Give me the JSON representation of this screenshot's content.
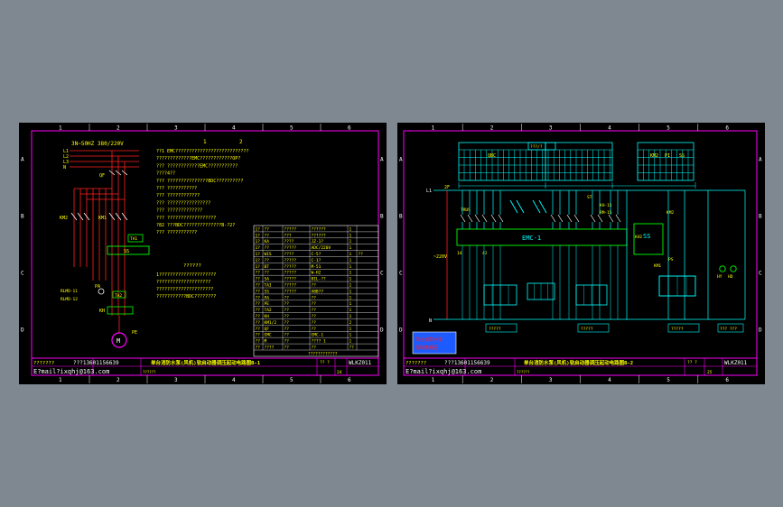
{
  "zones": {
    "cols": [
      "1",
      "2",
      "3",
      "4",
      "5",
      "6"
    ],
    "rows": [
      "A",
      "B",
      "C",
      "D"
    ]
  },
  "sheet1": {
    "supply": "3N~50HZ 380/220V",
    "phases": [
      "L1",
      "L2",
      "L3",
      "N"
    ],
    "labels": {
      "qf": "QF",
      "km2": "KM2",
      "km1": "KM1",
      "tai": "TA1",
      "ss": "SS",
      "pa": "PA",
      "rlmd11": "RLMD-11",
      "rlmd12": "RLMD-12",
      "tai2": "TA2",
      "kh": "KH",
      "m": "M",
      "pe": "PE"
    },
    "notes_header": [
      "1",
      "2"
    ],
    "notes": [
      "??1 EMC???????????????????????????",
      "?????????????EMC????????????OP?",
      "??? ????????????EMC???????????",
      "????4??",
      "??? ???????????????BDC??????????",
      "??? ???????????",
      "??? ????????????",
      "??? ????????????????",
      "??? ?????????????",
      "??? ??????????????????",
      "?82 ???BDC??????????????B-?2?",
      "??? ???????????"
    ],
    "mid_title": "??????",
    "mid_notes": [
      "1?????????????????????",
      "????????????????????",
      "?????????????????????",
      "???????????BDC????????"
    ],
    "table": {
      "rows": [
        [
          "1?",
          "??",
          "?????",
          "??????",
          "1",
          ""
        ],
        [
          "1?",
          "??",
          "???",
          "??????",
          "1",
          ""
        ],
        [
          "1?",
          "KA",
          "????",
          "JZ-1?",
          "1",
          ""
        ],
        [
          "1?",
          "??",
          "?????",
          "ADC/220V",
          "1",
          ""
        ],
        [
          "1?",
          "WIS",
          "????",
          "C-5?",
          "1",
          "??"
        ],
        [
          "1?",
          "??",
          "?????",
          "C-1?",
          "1",
          ""
        ],
        [
          "1?",
          "BT",
          "?????",
          "M-51",
          "1",
          ""
        ],
        [
          "??",
          "??",
          "?????",
          "W-H2",
          "1",
          ""
        ],
        [
          "??",
          "SA",
          "?????",
          "BIL-??",
          "1",
          ""
        ],
        [
          "??",
          "TAI",
          "?????",
          "??",
          "1",
          ""
        ],
        [
          "??",
          "SS",
          "?????",
          "ABB?7",
          "1",
          ""
        ],
        [
          "??",
          "PA",
          "??",
          "??",
          "1",
          ""
        ],
        [
          "??",
          "PE",
          "??",
          "??",
          "1",
          ""
        ],
        [
          "??",
          "TA2",
          "??",
          "??",
          "1",
          ""
        ],
        [
          "??",
          "KH",
          "??",
          "??",
          "1",
          ""
        ],
        [
          "??",
          "KM1/2",
          "??",
          "??",
          "2",
          ""
        ],
        [
          "??",
          "QF",
          "??",
          "??",
          "1",
          ""
        ],
        [
          "??",
          "EMC",
          "??",
          "EMC-1",
          "1",
          ""
        ],
        [
          "??",
          "M",
          "??",
          "???? 1",
          "1",
          ""
        ],
        [
          "??",
          "????",
          "??",
          "??",
          "??",
          ""
        ]
      ],
      "footer": "????????????"
    },
    "title_block": {
      "designer": "???????",
      "phone": "???13601156639",
      "email": "E?mail?ixqhj@163.com",
      "title": "单台消防水泵(风机)软启动器调压起动电路图B-1",
      "drawing_no": "WLKZ011",
      "small_left": "??????",
      "small_mid": "?? ?",
      "page": "24"
    }
  },
  "sheet2": {
    "top_box_label": "???/?",
    "top_labels": [
      "QBC",
      "KM2",
      "PI",
      "SS"
    ],
    "labels": {
      "l1": "L1",
      "wire2f": "2F",
      "trus": "TRUS",
      "emc": "EMC-1",
      "st": "ST",
      "kh": "KH-15",
      "rm": "RM-15",
      "ss": "SS",
      "km2": "KM2",
      "km1": "KM1",
      "kh2": "KH2",
      "n": "N",
      "v220": "~220V",
      "w14": "14",
      "w42": "42",
      "ps": "PS",
      "hy": "HY",
      "hd": "HD"
    },
    "stamp": [
      "单台消防水泵",
      "控制电路图"
    ],
    "bottom_boxes": [
      "?????",
      "?????",
      "?????",
      "??? ???"
    ],
    "title_block": {
      "designer": "???????",
      "phone": "???13601156639",
      "email": "E?mail?ixqhj@163.com",
      "title": "单台消防水泵(风机)软启动器调压起动电路图B-2",
      "drawing_no": "WLKZ011",
      "small_left": "??????",
      "small_mid": "?? ?",
      "page": "25"
    }
  },
  "colors": {
    "frame": "#ff00ff",
    "grid": "#ffffff",
    "yellow": "#ffff00",
    "red": "#ff2020",
    "green": "#00ff00",
    "cyan": "#00ffff",
    "blue": "#1e5bff"
  }
}
